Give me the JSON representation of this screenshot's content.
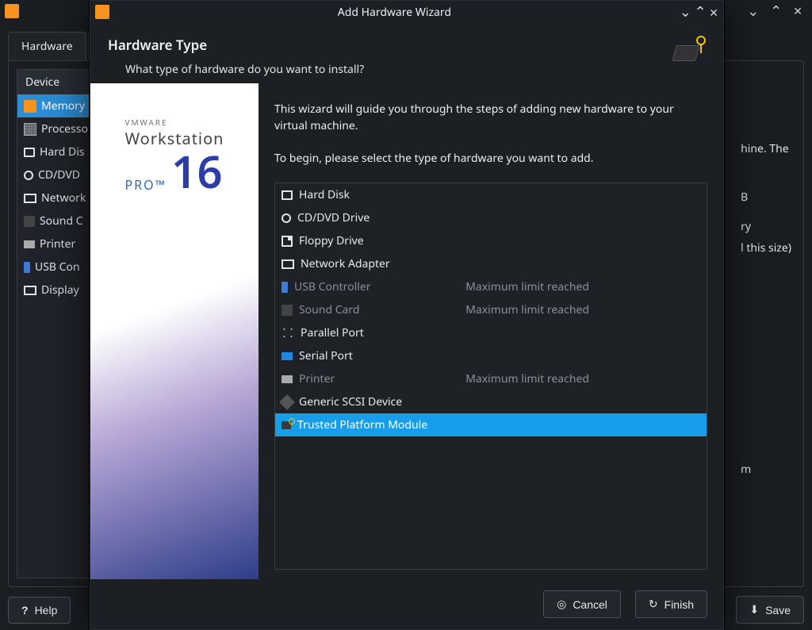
{
  "parent": {
    "tab_label_partial": "(",
    "active_tab": "Hardware",
    "device_header": "Device",
    "devices": [
      {
        "icon": "ic-mem",
        "label": "Memory",
        "selected": true
      },
      {
        "icon": "ic-cpu",
        "label": "Processo"
      },
      {
        "icon": "ic-rect",
        "label": "Hard Dis"
      },
      {
        "icon": "ic-circ",
        "label": "CD/DVD"
      },
      {
        "icon": "ic-net",
        "label": "Network"
      },
      {
        "icon": "ic-snd",
        "label": "Sound C"
      },
      {
        "icon": "ic-prn",
        "label": "Printer"
      },
      {
        "icon": "ic-usb",
        "label": "USB Con"
      },
      {
        "icon": "ic-disp",
        "label": "Display"
      }
    ],
    "right_frag": [
      "hine. The",
      "B",
      "ry",
      "l this size)",
      "m"
    ],
    "buttons": {
      "help": "Help",
      "save": "Save"
    }
  },
  "wizard": {
    "title": "Add Hardware Wizard",
    "heading": "Hardware Type",
    "subheading": "What type of hardware do you want to install?",
    "intro1": "This wizard will guide you through the steps of adding new hardware to your virtual machine.",
    "intro2": "To begin, please select the type of hardware you want to add.",
    "side": {
      "vmware": "VMWARE",
      "ws": "Workstation",
      "pro": "PRO™",
      "num": "16"
    },
    "hw": [
      {
        "icon": "ic-rect",
        "label": "Hard Disk"
      },
      {
        "icon": "ic-circ",
        "label": "CD/DVD Drive"
      },
      {
        "icon": "ic-flop",
        "label": "Floppy Drive"
      },
      {
        "icon": "ic-net",
        "label": "Network Adapter"
      },
      {
        "icon": "ic-usb",
        "label": "USB Controller",
        "status": "Maximum limit reached",
        "disabled": true
      },
      {
        "icon": "ic-snd",
        "label": "Sound Card",
        "status": "Maximum limit reached",
        "disabled": true
      },
      {
        "icon": "ic-par",
        "label": "Parallel Port"
      },
      {
        "icon": "ic-ser",
        "label": "Serial Port"
      },
      {
        "icon": "ic-prn",
        "label": "Printer",
        "status": "Maximum limit reached",
        "disabled": true
      },
      {
        "icon": "ic-scsi",
        "label": "Generic SCSI Device"
      },
      {
        "icon": "ic-tpm",
        "label": "Trusted Platform Module",
        "selected": true
      }
    ],
    "buttons": {
      "cancel": "Cancel",
      "finish": "Finish"
    }
  }
}
